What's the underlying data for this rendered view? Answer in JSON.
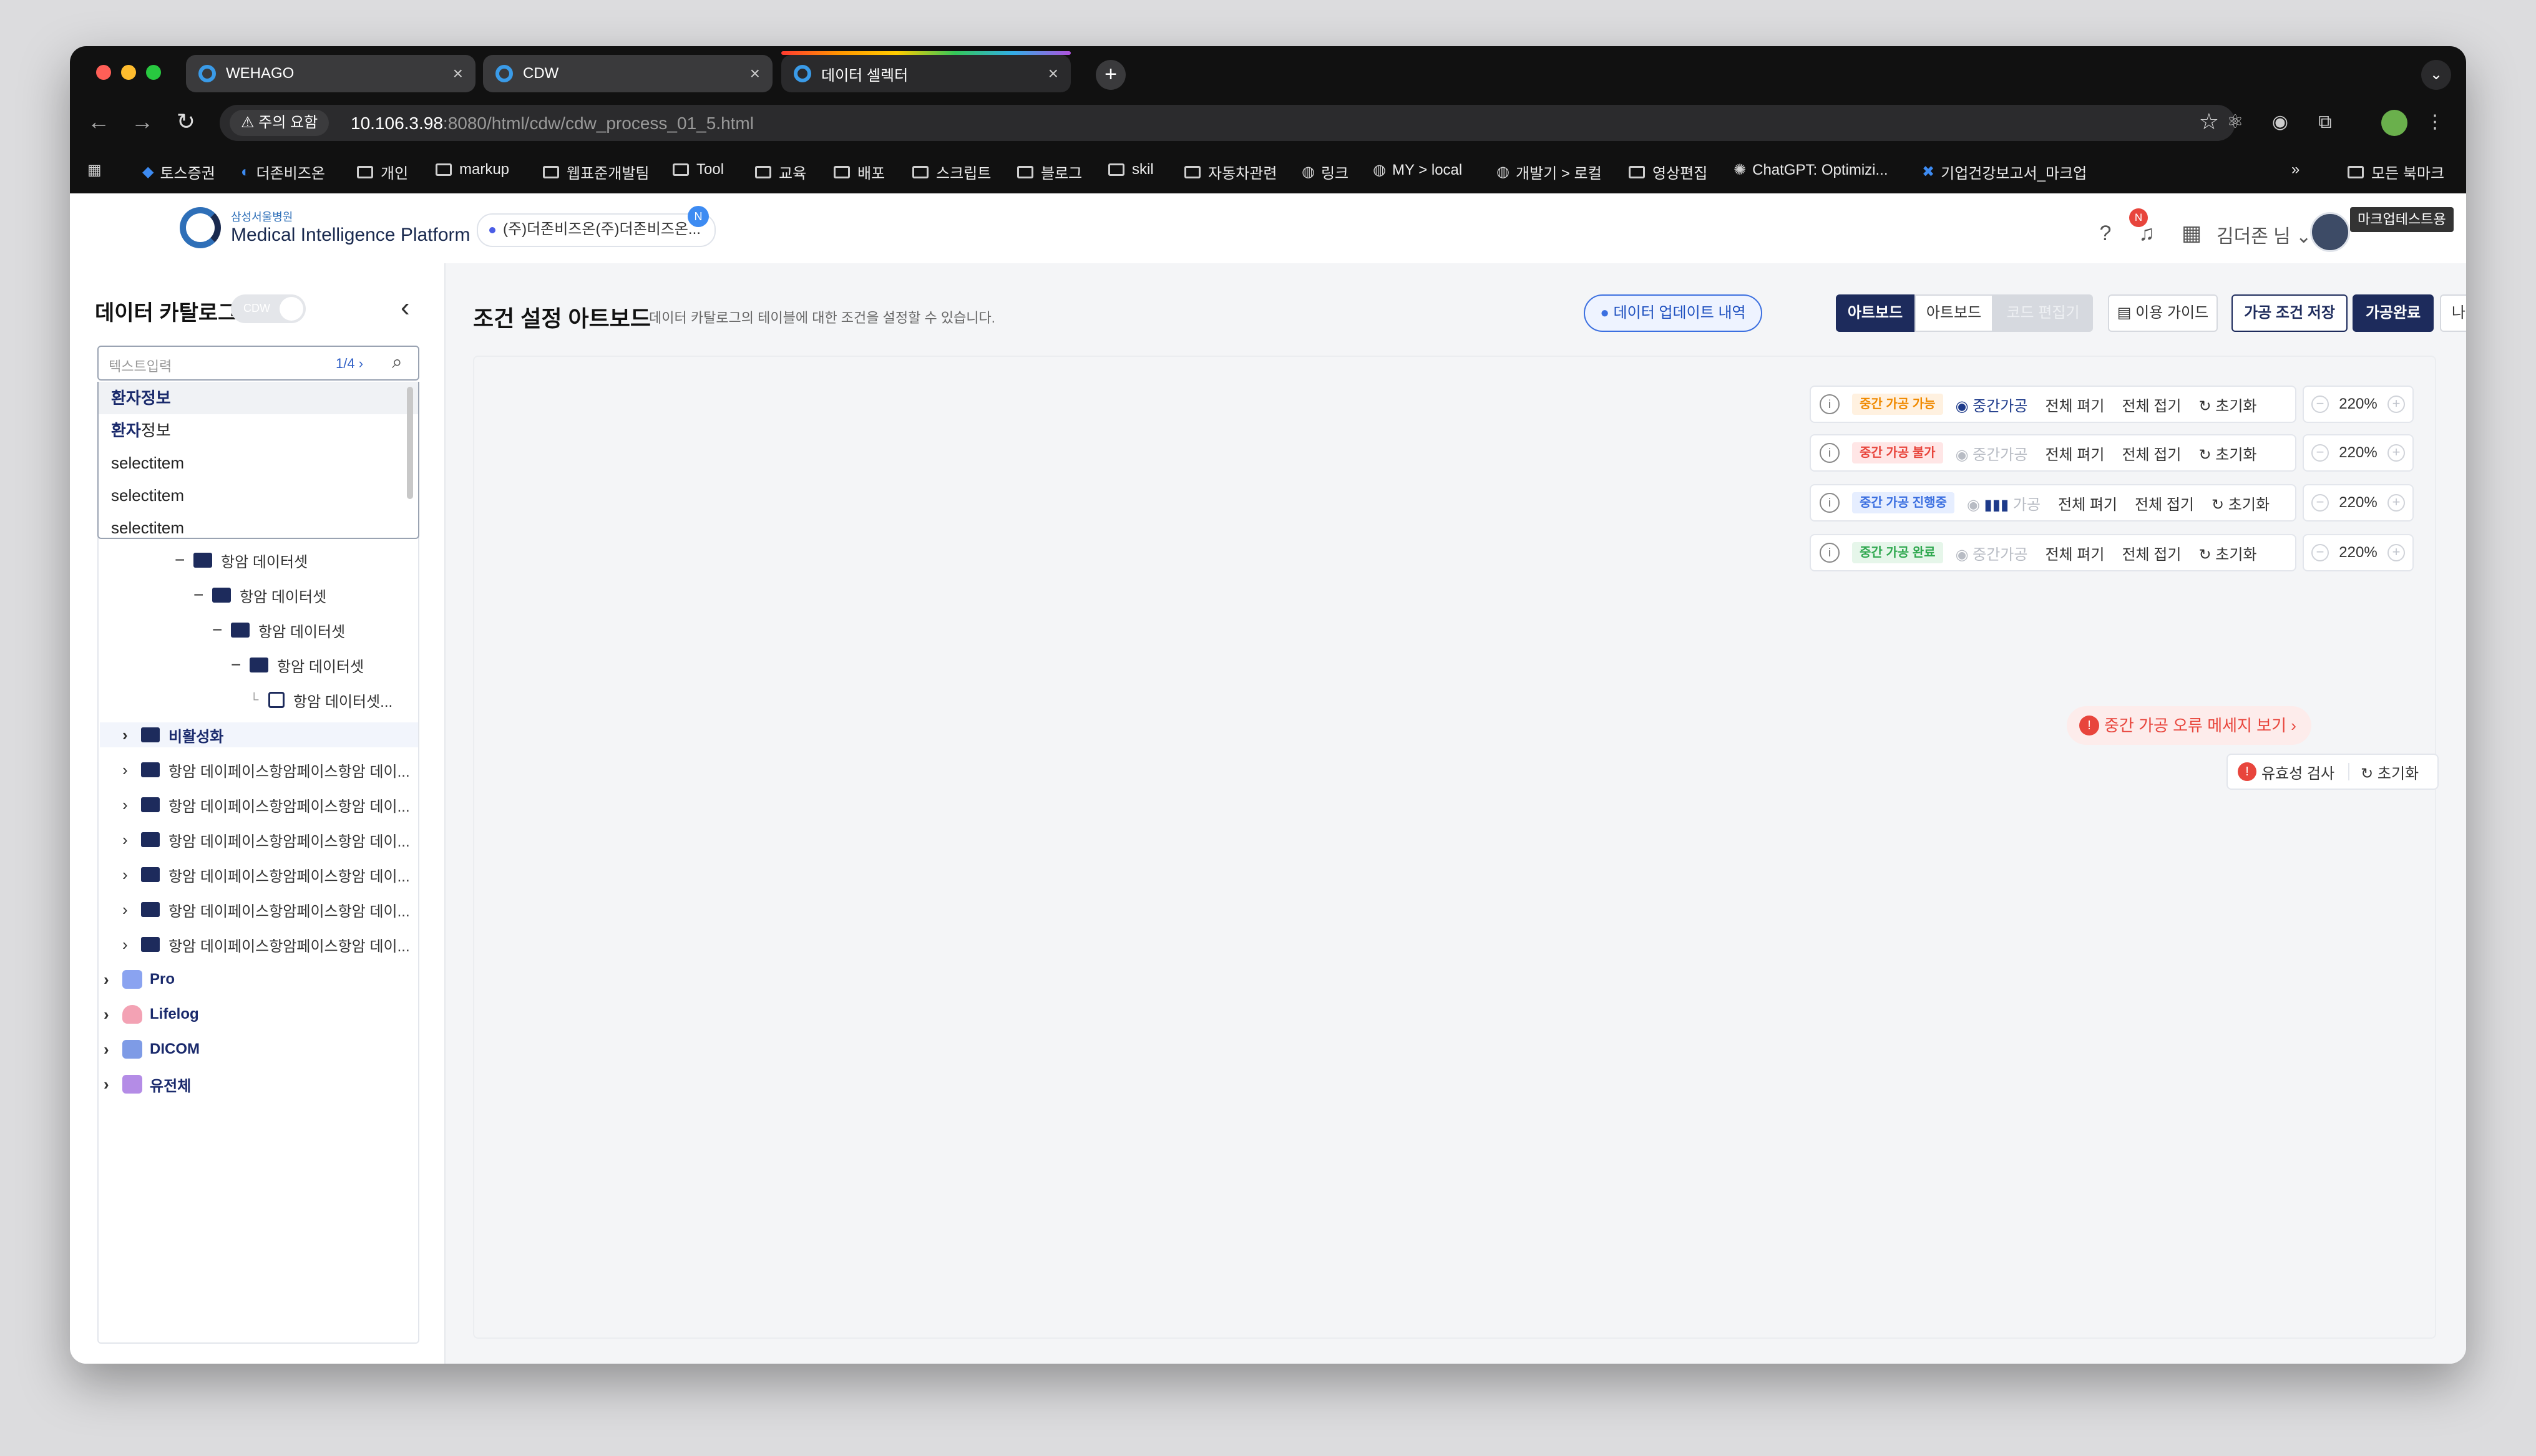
{
  "browser": {
    "tabs": [
      {
        "title": "WEHAGO",
        "close": "×"
      },
      {
        "title": "CDW",
        "close": "×"
      },
      {
        "title": "데이터 셀렉터",
        "close": "×"
      }
    ],
    "new_tab": "+",
    "warning": "⚠ 주의 요함",
    "url_host": "10.106.3.98",
    "url_rest": ":8080/html/cdw/cdw_process_01_5.html",
    "bookmarks": [
      "토스증권",
      "더존비즈온",
      "개인",
      "markup",
      "웹표준개발팀",
      "Tool",
      "교육",
      "배포",
      "스크립트",
      "블로그",
      "skil",
      "자동차관련",
      "링크",
      "MY > local",
      "개발기 > 로컬",
      "영상편집",
      "ChatGPT: Optimizi...",
      "기업건강보고서_마크업"
    ],
    "bookmarks_more": "»",
    "all_bookmarks": "모든 북마크"
  },
  "header": {
    "logo_sub": "삼성서울병원",
    "logo_main": "Medical Intelligence Platform",
    "company": "(주)더존비즈온(주)더존비즈온...",
    "company_badge": "N",
    "notif_badge": "N",
    "user": "김더존 님 ⌄",
    "user_tag": "마크업테스트용"
  },
  "sidebar": {
    "title": "데이터 카탈로그",
    "toggle": "CDW",
    "search_placeholder": "텍스트입력",
    "search_count": "1/4 ›",
    "dropdown": [
      {
        "strong": "환자",
        "rest": "정보"
      },
      {
        "strong": "환자",
        "rest": "정보"
      },
      {
        "strong": "",
        "rest": "selectitem"
      },
      {
        "strong": "",
        "rest": "selectitem"
      },
      {
        "strong": "",
        "rest": "selectitem"
      }
    ],
    "tree": [
      {
        "label": "항암 데이터셋"
      },
      {
        "label": "항암 데이터셋"
      },
      {
        "label": "항암 데이터셋"
      },
      {
        "label": "항암 데이터셋"
      },
      {
        "label": "항암 데이터셋..."
      },
      {
        "label": "비활성화"
      },
      {
        "label": "항암 데이페이스항암페이스항암 데이..."
      },
      {
        "label": "항암 데이페이스항암페이스항암 데이..."
      },
      {
        "label": "항암 데이페이스항암페이스항암 데이..."
      },
      {
        "label": "항암 데이페이스항암페이스항암 데이..."
      },
      {
        "label": "항암 데이페이스항암페이스항암 데이..."
      },
      {
        "label": "항암 데이페이스항암페이스항암 데이..."
      }
    ],
    "categories": [
      "Pro",
      "Lifelog",
      "DICOM",
      "유전체"
    ]
  },
  "main": {
    "title": "조건 설정 아트보드",
    "desc": "데이터 카탈로그의 테이블에 대한 조건을 설정할 수 있습니다.",
    "buttons": {
      "update_history": "데이터 업데이트 내역",
      "artboard_active": "아트보드",
      "artboard": "아트보드",
      "code_edit": "코드 편집기",
      "guide": "이용 가이드",
      "save_condition": "가공 조건 저장",
      "complete": "가공완료",
      "exit": "나가기"
    },
    "rows": [
      {
        "status": "중간 가공 가능",
        "action": "중간가공"
      },
      {
        "status": "중간 가공 불가",
        "action": "중간가공"
      },
      {
        "status": "중간 가공 진행중",
        "action": "가공"
      },
      {
        "status": "중간 가공 완료",
        "action": "중간가공"
      }
    ],
    "expand_all": "전체 펴기",
    "collapse_all": "전체 접기",
    "reset": "초기화",
    "zoom": "220%",
    "error_message": "중간 가공 오류 메세지 보기 ›",
    "validity": "유효성 검사",
    "validity_reset": "초기화"
  }
}
